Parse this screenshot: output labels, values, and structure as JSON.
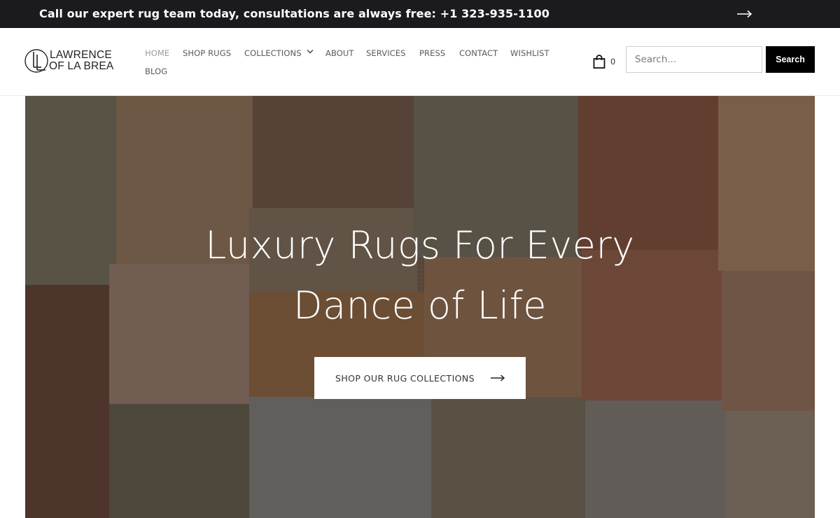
{
  "announcement": {
    "text": "Call our expert rug team today, consultations are always free: +1 323-935-1100",
    "arrow_icon": "arrow-right-icon"
  },
  "logo": {
    "line1": "LAWRENCE",
    "line2": "OF LA BREA",
    "mark_icon": "ll-monogram-icon"
  },
  "nav": {
    "items": [
      {
        "label": "HOME",
        "active": true
      },
      {
        "label": "SHOP RUGS"
      },
      {
        "label": "COLLECTIONS",
        "has_dropdown": true
      },
      {
        "label": "ABOUT"
      },
      {
        "label": "SERVICES"
      },
      {
        "label": "PRESS"
      },
      {
        "label": "CONTACT"
      },
      {
        "label": "WISHLIST"
      },
      {
        "label": "BLOG"
      }
    ]
  },
  "cart": {
    "icon": "shopping-bag-icon",
    "count": "0"
  },
  "search": {
    "placeholder": "Search...",
    "value": "",
    "button_label": "Search"
  },
  "hero": {
    "title_line1": "Luxury Rugs For Every",
    "title_line2": "Dance of Life",
    "cta_label": "SHOP OUR RUG COLLECTIONS",
    "cta_icon": "arrow-right-icon"
  },
  "colors": {
    "topbar_bg": "#1b1b1f",
    "button_bg": "#000000",
    "nav_text": "#5a5a5a",
    "nav_active": "#9a9a9a"
  }
}
